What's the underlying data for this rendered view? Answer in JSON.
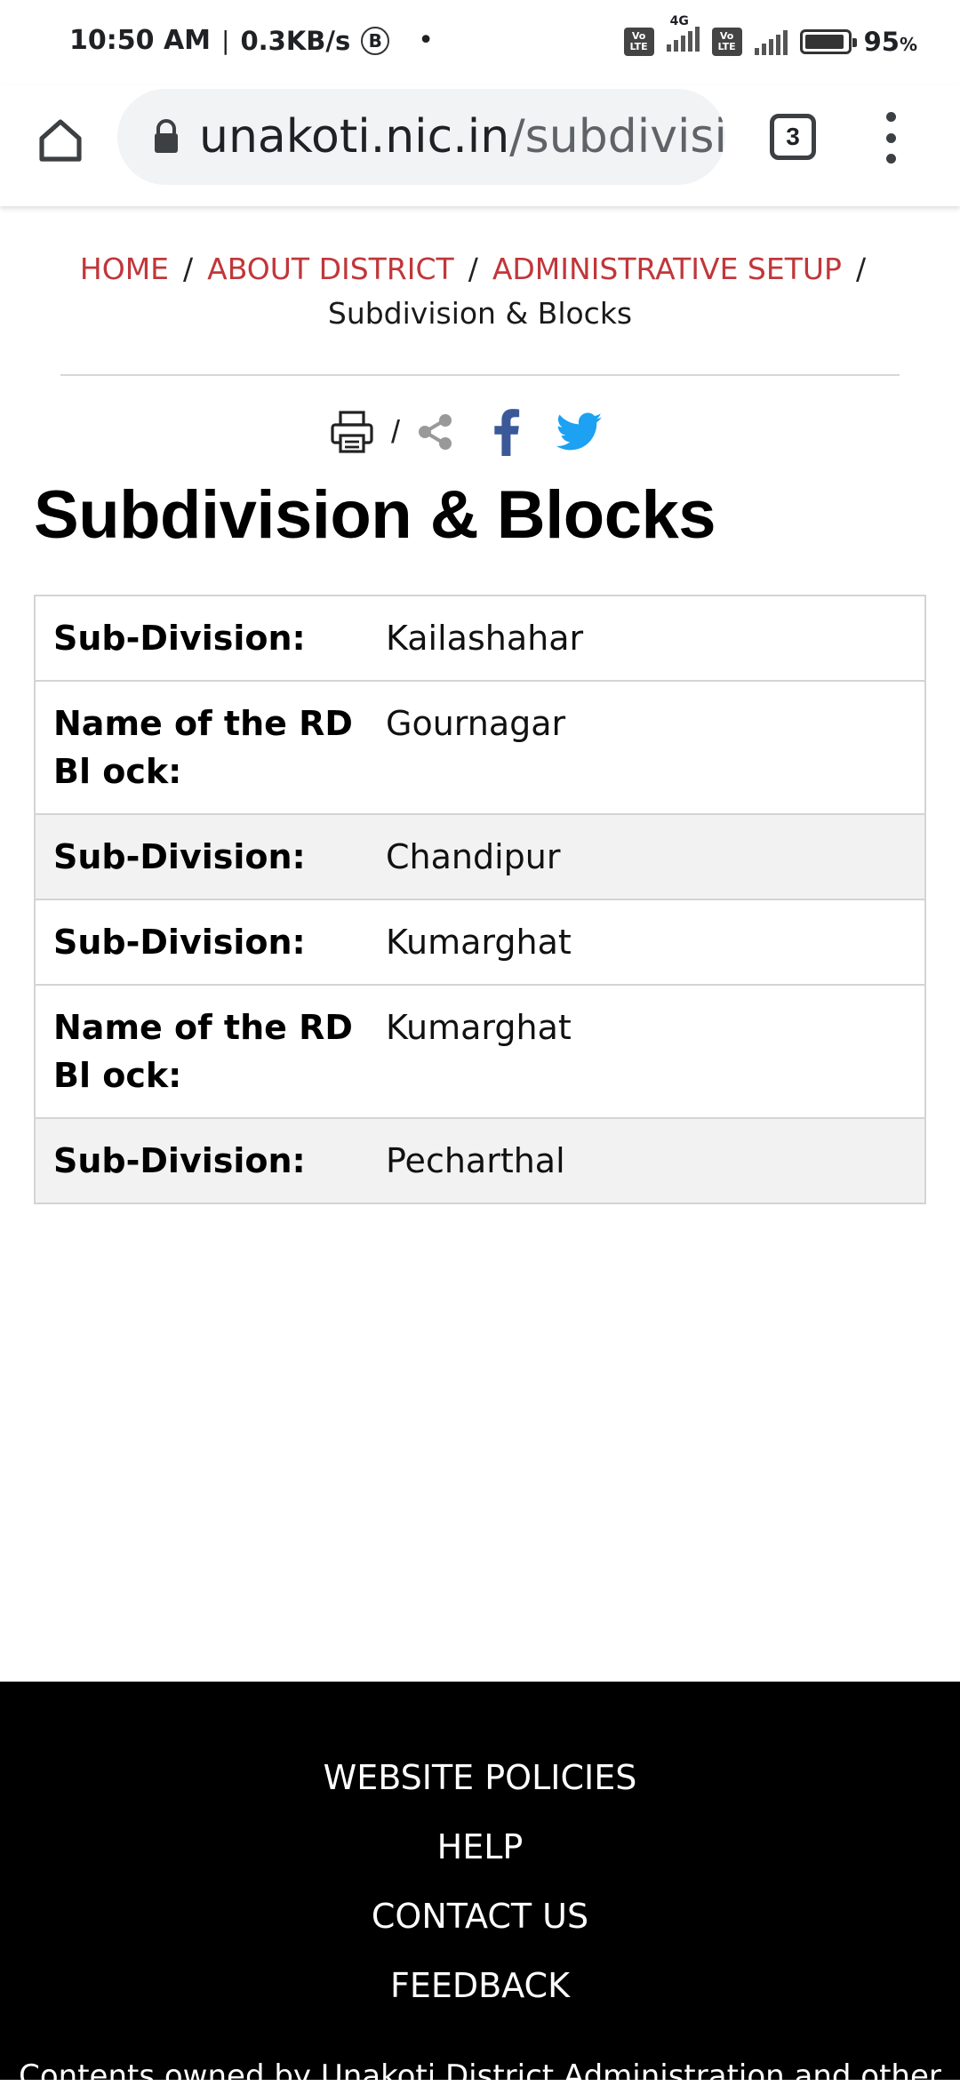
{
  "status_bar": {
    "time": "10:50 AM",
    "speed": "0.3KB/s",
    "badge": "B",
    "dot": "•",
    "network_4g": "4G",
    "volte": "Vo LTE",
    "battery": "95",
    "battery_unit": "%",
    "battery_level": 0.95
  },
  "browser": {
    "url_domain": "unakoti.nic.in",
    "url_path": "/subdivisi",
    "tab_count": "3"
  },
  "breadcrumb": {
    "items": [
      "HOME",
      "ABOUT DISTRICT",
      "ADMINISTRATIVE SETUP"
    ],
    "separator": "/",
    "current": "Subdivision & Blocks"
  },
  "share": {
    "separator": "/"
  },
  "page": {
    "title": "Subdivision & Blocks"
  },
  "table": {
    "rows": [
      {
        "label": "Sub-Division:",
        "value": "Kailashahar"
      },
      {
        "label": "Name of the RD Bl ock:",
        "value": "Gournagar"
      },
      {
        "label": "Sub-Division:",
        "value": "Chandipur"
      },
      {
        "label": "Sub-Division:",
        "value": "Kumarghat"
      },
      {
        "label": "Name of the RD Bl ock:",
        "value": "Kumarghat"
      },
      {
        "label": "Sub-Division:",
        "value": "Pecharthal"
      }
    ]
  },
  "footer": {
    "links": [
      "WEBSITE POLICIES",
      "HELP",
      "CONTACT US",
      "FEEDBACK"
    ],
    "note": "Contents owned by Unakoti District Administration and other"
  },
  "colors": {
    "breadcrumb_link": "#c1363a",
    "facebook": "#3b5998",
    "twitter": "#1da1f2",
    "footer_bg": "#000000"
  }
}
